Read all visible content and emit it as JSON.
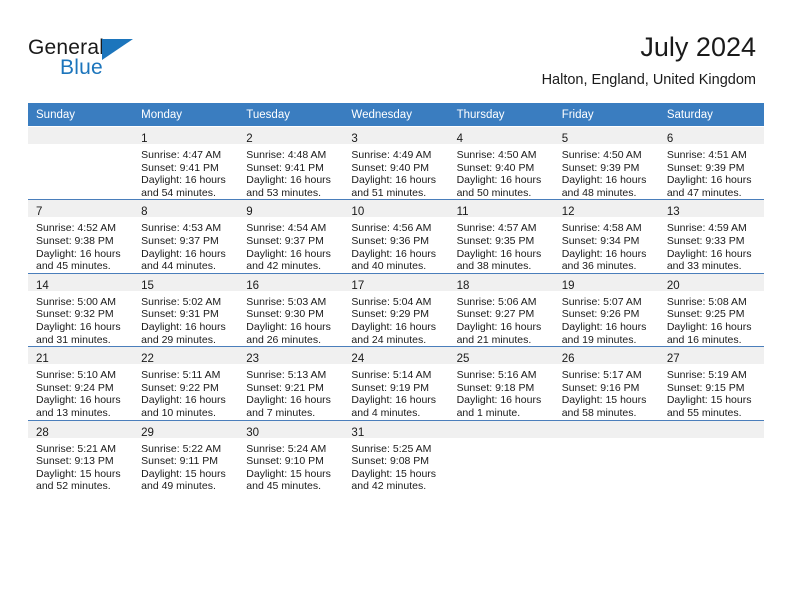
{
  "brand": {
    "name_part1": "General",
    "name_part2": "Blue",
    "logo_icon": "blue-triangle-flag-icon"
  },
  "header": {
    "month_title": "July 2024",
    "location": "Halton, England, United Kingdom"
  },
  "colors": {
    "header_blue": "#3a7dc0",
    "brand_blue": "#1c75bc",
    "daynum_bar": "#f0f0f0",
    "row_border": "#4a7ebb",
    "text": "#1a1a1a"
  },
  "weekday_headers": [
    "Sunday",
    "Monday",
    "Tuesday",
    "Wednesday",
    "Thursday",
    "Friday",
    "Saturday"
  ],
  "weeks": [
    [
      {
        "day": "",
        "lines": []
      },
      {
        "day": "1",
        "lines": [
          "Sunrise: 4:47 AM",
          "Sunset: 9:41 PM",
          "Daylight: 16 hours",
          "and 54 minutes."
        ]
      },
      {
        "day": "2",
        "lines": [
          "Sunrise: 4:48 AM",
          "Sunset: 9:41 PM",
          "Daylight: 16 hours",
          "and 53 minutes."
        ]
      },
      {
        "day": "3",
        "lines": [
          "Sunrise: 4:49 AM",
          "Sunset: 9:40 PM",
          "Daylight: 16 hours",
          "and 51 minutes."
        ]
      },
      {
        "day": "4",
        "lines": [
          "Sunrise: 4:50 AM",
          "Sunset: 9:40 PM",
          "Daylight: 16 hours",
          "and 50 minutes."
        ]
      },
      {
        "day": "5",
        "lines": [
          "Sunrise: 4:50 AM",
          "Sunset: 9:39 PM",
          "Daylight: 16 hours",
          "and 48 minutes."
        ]
      },
      {
        "day": "6",
        "lines": [
          "Sunrise: 4:51 AM",
          "Sunset: 9:39 PM",
          "Daylight: 16 hours",
          "and 47 minutes."
        ]
      }
    ],
    [
      {
        "day": "7",
        "lines": [
          "Sunrise: 4:52 AM",
          "Sunset: 9:38 PM",
          "Daylight: 16 hours",
          "and 45 minutes."
        ]
      },
      {
        "day": "8",
        "lines": [
          "Sunrise: 4:53 AM",
          "Sunset: 9:37 PM",
          "Daylight: 16 hours",
          "and 44 minutes."
        ]
      },
      {
        "day": "9",
        "lines": [
          "Sunrise: 4:54 AM",
          "Sunset: 9:37 PM",
          "Daylight: 16 hours",
          "and 42 minutes."
        ]
      },
      {
        "day": "10",
        "lines": [
          "Sunrise: 4:56 AM",
          "Sunset: 9:36 PM",
          "Daylight: 16 hours",
          "and 40 minutes."
        ]
      },
      {
        "day": "11",
        "lines": [
          "Sunrise: 4:57 AM",
          "Sunset: 9:35 PM",
          "Daylight: 16 hours",
          "and 38 minutes."
        ]
      },
      {
        "day": "12",
        "lines": [
          "Sunrise: 4:58 AM",
          "Sunset: 9:34 PM",
          "Daylight: 16 hours",
          "and 36 minutes."
        ]
      },
      {
        "day": "13",
        "lines": [
          "Sunrise: 4:59 AM",
          "Sunset: 9:33 PM",
          "Daylight: 16 hours",
          "and 33 minutes."
        ]
      }
    ],
    [
      {
        "day": "14",
        "lines": [
          "Sunrise: 5:00 AM",
          "Sunset: 9:32 PM",
          "Daylight: 16 hours",
          "and 31 minutes."
        ]
      },
      {
        "day": "15",
        "lines": [
          "Sunrise: 5:02 AM",
          "Sunset: 9:31 PM",
          "Daylight: 16 hours",
          "and 29 minutes."
        ]
      },
      {
        "day": "16",
        "lines": [
          "Sunrise: 5:03 AM",
          "Sunset: 9:30 PM",
          "Daylight: 16 hours",
          "and 26 minutes."
        ]
      },
      {
        "day": "17",
        "lines": [
          "Sunrise: 5:04 AM",
          "Sunset: 9:29 PM",
          "Daylight: 16 hours",
          "and 24 minutes."
        ]
      },
      {
        "day": "18",
        "lines": [
          "Sunrise: 5:06 AM",
          "Sunset: 9:27 PM",
          "Daylight: 16 hours",
          "and 21 minutes."
        ]
      },
      {
        "day": "19",
        "lines": [
          "Sunrise: 5:07 AM",
          "Sunset: 9:26 PM",
          "Daylight: 16 hours",
          "and 19 minutes."
        ]
      },
      {
        "day": "20",
        "lines": [
          "Sunrise: 5:08 AM",
          "Sunset: 9:25 PM",
          "Daylight: 16 hours",
          "and 16 minutes."
        ]
      }
    ],
    [
      {
        "day": "21",
        "lines": [
          "Sunrise: 5:10 AM",
          "Sunset: 9:24 PM",
          "Daylight: 16 hours",
          "and 13 minutes."
        ]
      },
      {
        "day": "22",
        "lines": [
          "Sunrise: 5:11 AM",
          "Sunset: 9:22 PM",
          "Daylight: 16 hours",
          "and 10 minutes."
        ]
      },
      {
        "day": "23",
        "lines": [
          "Sunrise: 5:13 AM",
          "Sunset: 9:21 PM",
          "Daylight: 16 hours",
          "and 7 minutes."
        ]
      },
      {
        "day": "24",
        "lines": [
          "Sunrise: 5:14 AM",
          "Sunset: 9:19 PM",
          "Daylight: 16 hours",
          "and 4 minutes."
        ]
      },
      {
        "day": "25",
        "lines": [
          "Sunrise: 5:16 AM",
          "Sunset: 9:18 PM",
          "Daylight: 16 hours",
          "and 1 minute."
        ]
      },
      {
        "day": "26",
        "lines": [
          "Sunrise: 5:17 AM",
          "Sunset: 9:16 PM",
          "Daylight: 15 hours",
          "and 58 minutes."
        ]
      },
      {
        "day": "27",
        "lines": [
          "Sunrise: 5:19 AM",
          "Sunset: 9:15 PM",
          "Daylight: 15 hours",
          "and 55 minutes."
        ]
      }
    ],
    [
      {
        "day": "28",
        "lines": [
          "Sunrise: 5:21 AM",
          "Sunset: 9:13 PM",
          "Daylight: 15 hours",
          "and 52 minutes."
        ]
      },
      {
        "day": "29",
        "lines": [
          "Sunrise: 5:22 AM",
          "Sunset: 9:11 PM",
          "Daylight: 15 hours",
          "and 49 minutes."
        ]
      },
      {
        "day": "30",
        "lines": [
          "Sunrise: 5:24 AM",
          "Sunset: 9:10 PM",
          "Daylight: 15 hours",
          "and 45 minutes."
        ]
      },
      {
        "day": "31",
        "lines": [
          "Sunrise: 5:25 AM",
          "Sunset: 9:08 PM",
          "Daylight: 15 hours",
          "and 42 minutes."
        ]
      },
      {
        "day": "",
        "lines": []
      },
      {
        "day": "",
        "lines": []
      },
      {
        "day": "",
        "lines": []
      }
    ]
  ]
}
